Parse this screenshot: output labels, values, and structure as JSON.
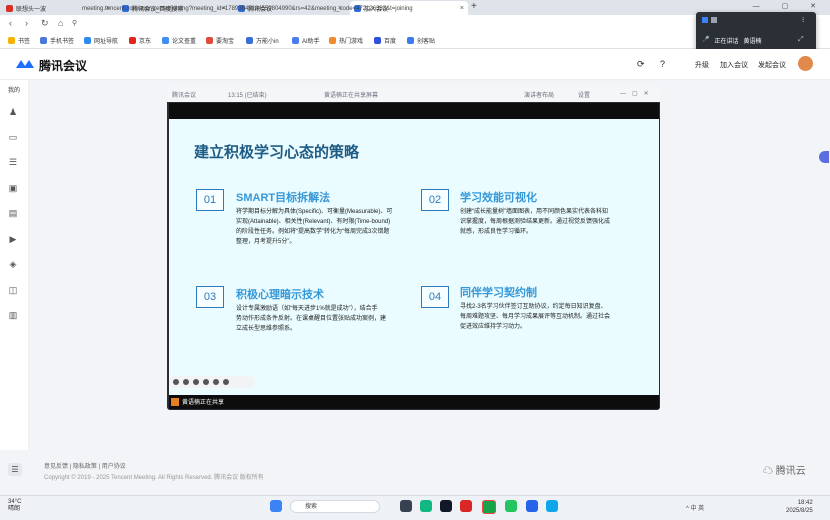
{
  "browser": {
    "tabs": [
      {
        "title": "联想头一波",
        "color": "#d93025"
      },
      {
        "title": "腾讯会议_百度搜索",
        "color": "#2d6cdf"
      },
      {
        "title": "腾讯会议",
        "color": "#2d6cdf"
      },
      {
        "title": "加入会议",
        "color": "#2d6cdf"
      }
    ],
    "url": "meeting.tencent.com/user-center/joining?meeting_id=17893849184559804990&rs=42&meeting_code=472126383&t=joining",
    "bookmarks": [
      "书签",
      "手机书签",
      "网址导航",
      "京东",
      "论文查重",
      "要淘宝",
      "万能小in",
      "AI助手",
      "热门游戏",
      "百度",
      "创客贴"
    ]
  },
  "share_popup": {
    "status": "正在讲话",
    "speaker": "黄语楠"
  },
  "app": {
    "title": "腾讯会议",
    "header_links": [
      "升级",
      "加入会议",
      "发起会议"
    ]
  },
  "sidebar": {
    "first_label": "我的"
  },
  "meeting_bar": {
    "app_name": "腾讯会议",
    "time": "13:15 (已结束)",
    "sharer_label": "黄语楠正在共享屏幕",
    "view": "演讲者布局",
    "settings": "设置"
  },
  "slide": {
    "title": "建立积极学习心态的策略",
    "items": [
      {
        "num": "01",
        "title": "SMART目标拆解法",
        "body": [
          "将学期目标分解为具体(Specific)、可衡量(Measurable)、可",
          "实现(Attainable)、相关性(Relevant)、有时限(Time-bound)",
          "的阶段性任务。例如将“提高数学”转化为“每周完成3次错题",
          "整理，月考提升5分”。"
        ]
      },
      {
        "num": "02",
        "title": "学习效能可视化",
        "body": [
          "创建“成长能量树”墙面图表，用不同颜色果实代表各科知",
          "识掌握度，每周根据测验结果更新。通过视觉反馈强化成",
          "就感，形成良性学习循环。"
        ]
      },
      {
        "num": "03",
        "title": "积极心理暗示技术",
        "body": [
          "设计专属激励语（如“每天进步1%就是成功”），结合手",
          "势动作形成条件反射。在课桌醒目位置张贴成功案例，建",
          "立成长型思维参照系。"
        ]
      },
      {
        "num": "04",
        "title": "同伴学习契约制",
        "body": [
          "寻找2-3名学习伙伴签订互助协议，约定每日知识复盘、",
          "每周难题攻坚、每月学习成果展评等互动机制。通过社会",
          "促进效应维持学习动力。"
        ]
      }
    ]
  },
  "share_tag": "黄语楠正在共享",
  "footer": {
    "links": "意见反馈 | 隐私政策 | 用户协议",
    "copyright": "Copyright © 2019 - 2025 Tencent Meeting. All Rights Reserved. 腾讯会议 版权所有",
    "brand": "腾讯云"
  },
  "taskbar": {
    "weather_temp": "34°C",
    "weather_desc": "晴朗",
    "search": "搜索",
    "time": "18:42",
    "date": "2025/8/25",
    "tray": "^  中  英"
  },
  "colors": {
    "accent": "#2d7bbd",
    "title_blue": "#1f5c85",
    "subtitle_blue": "#3598d8",
    "slide_bg": "#eafcff"
  }
}
